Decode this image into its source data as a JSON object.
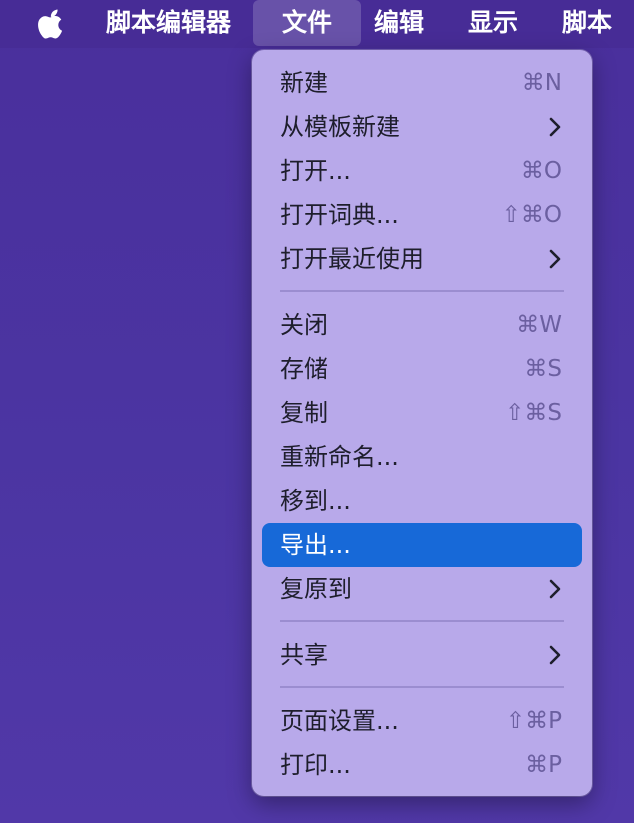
{
  "menubar": {
    "app_name": "脚本编辑器",
    "items": [
      {
        "label": "文件"
      },
      {
        "label": "编辑"
      },
      {
        "label": "显示"
      },
      {
        "label": "脚本"
      }
    ]
  },
  "file_menu": {
    "items": [
      {
        "label": "新建",
        "shortcut": "⌘N"
      },
      {
        "label": "从模板新建",
        "submenu": true
      },
      {
        "label": "打开...",
        "shortcut": "⌘O"
      },
      {
        "label": "打开词典...",
        "shortcut": "⇧⌘O"
      },
      {
        "label": "打开最近使用",
        "submenu": true
      },
      {
        "label": "关闭",
        "shortcut": "⌘W"
      },
      {
        "label": "存储",
        "shortcut": "⌘S"
      },
      {
        "label": "复制",
        "shortcut": "⇧⌘S"
      },
      {
        "label": "重新命名..."
      },
      {
        "label": "移到..."
      },
      {
        "label": "导出...",
        "selected": true
      },
      {
        "label": "复原到",
        "submenu": true
      },
      {
        "label": "共享",
        "submenu": true
      },
      {
        "label": "页面设置...",
        "shortcut": "⇧⌘P"
      },
      {
        "label": "打印...",
        "shortcut": "⌘P"
      }
    ]
  },
  "colors": {
    "desktop": "#4b35a2",
    "menu_background": "#b8a9ea",
    "selection": "#1769d8"
  }
}
